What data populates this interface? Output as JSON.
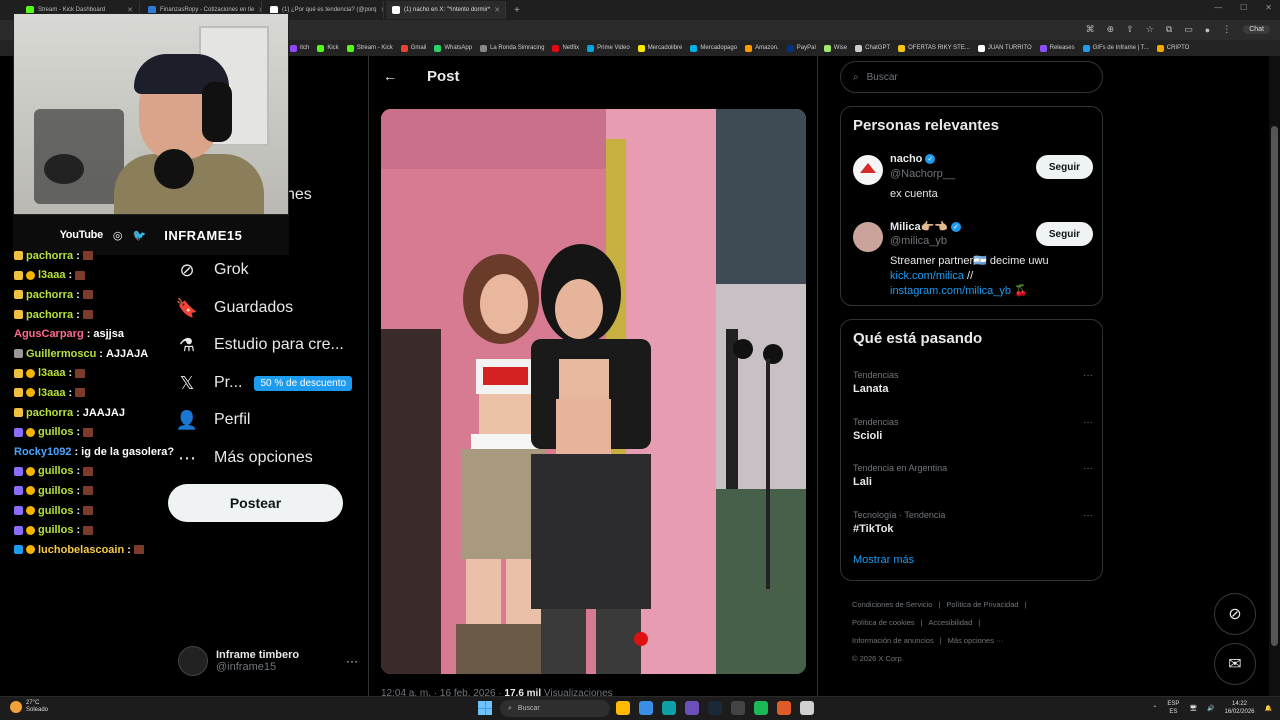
{
  "browser": {
    "tabs": [
      {
        "label": "Stream - Kick Dashboard",
        "color": "#53fc18"
      },
      {
        "label": "FinanzasRopy - Cotizaciones en tie",
        "color": "#2e7bd6"
      },
      {
        "label": "(1) ¿Por qué es tendencia? (@porq",
        "color": "#ffffff"
      },
      {
        "label": "(1) nacho en X: \"*intento dormir*",
        "color": "#ffffff"
      }
    ],
    "new_tab": "+",
    "chat_button": "Chat",
    "bookmarks": [
      {
        "label": "itch",
        "color": "#9146ff"
      },
      {
        "label": "Kick",
        "color": "#53fc18"
      },
      {
        "label": "Stream - Kick",
        "color": "#53fc18"
      },
      {
        "label": "Gmail",
        "color": "#ea4335"
      },
      {
        "label": "WhatsApp",
        "color": "#25d366"
      },
      {
        "label": "La Ronda Simracing",
        "color": "#888888"
      },
      {
        "label": "Netflix",
        "color": "#e50914"
      },
      {
        "label": "Prime Video",
        "color": "#00a8e1"
      },
      {
        "label": "Mercadolibre",
        "color": "#ffe600"
      },
      {
        "label": "Mercadopago",
        "color": "#00b1ea"
      },
      {
        "label": "Amazon.",
        "color": "#ff9900"
      },
      {
        "label": "PayPal",
        "color": "#003087"
      },
      {
        "label": "Wise",
        "color": "#9fe870"
      },
      {
        "label": "ChatGPT",
        "color": "#cccccc"
      },
      {
        "label": "OFERTAS RIKY STE...",
        "color": "#f5c518"
      },
      {
        "label": "JUAN TURRITO",
        "color": "#ffffff"
      },
      {
        "label": "Releases",
        "color": "#8a4fff"
      },
      {
        "label": "GIFs de Inframe | T...",
        "color": "#1d9bf0"
      },
      {
        "label": "CRIPTO",
        "color": "#f2a900"
      }
    ]
  },
  "stream_overlay": {
    "platform": "YouTube",
    "handle": "INFRAME15"
  },
  "chat": [
    {
      "user": "pachorra",
      "msg": "",
      "color": "#b7e23a",
      "emote": true,
      "badges": [
        "#f0c040"
      ]
    },
    {
      "user": "l3aaa",
      "msg": "",
      "color": "#b7e23a",
      "emote": true,
      "badges": [
        "#f0c040",
        "#f5b400"
      ]
    },
    {
      "user": "pachorra",
      "msg": "",
      "color": "#b7e23a",
      "emote": true,
      "badges": [
        "#f0c040"
      ]
    },
    {
      "user": "pachorra",
      "msg": "",
      "color": "#b7e23a",
      "emote": true,
      "badges": [
        "#f0c040"
      ]
    },
    {
      "user": "AgusCarparg",
      "msg": "asjjsa",
      "color": "#ff6b8b",
      "emote": false,
      "badges": []
    },
    {
      "user": "Guillermoscu",
      "msg": "AJJAJA",
      "color": "#b7e23a",
      "emote": false,
      "badges": [
        "#999999"
      ]
    },
    {
      "user": "l3aaa",
      "msg": "",
      "color": "#b7e23a",
      "emote": true,
      "badges": [
        "#f0c040",
        "#f5b400"
      ]
    },
    {
      "user": "l3aaa",
      "msg": "",
      "color": "#b7e23a",
      "emote": true,
      "badges": [
        "#f0c040",
        "#f5b400"
      ]
    },
    {
      "user": "pachorra",
      "msg": "JAAJAJ",
      "color": "#b7e23a",
      "emote": false,
      "badges": [
        "#f0c040"
      ]
    },
    {
      "user": "guillos",
      "msg": "",
      "color": "#b7e23a",
      "emote": true,
      "badges": [
        "#8a6cff",
        "#f5b400"
      ]
    },
    {
      "user": "Rocky1092",
      "msg": "ig de la gasolera?",
      "color": "#4aa3ff",
      "emote": false,
      "badges": []
    },
    {
      "user": "guillos",
      "msg": "",
      "color": "#b7e23a",
      "emote": true,
      "badges": [
        "#8a6cff",
        "#f5b400"
      ]
    },
    {
      "user": "guillos",
      "msg": "",
      "color": "#b7e23a",
      "emote": true,
      "badges": [
        "#8a6cff",
        "#f5b400"
      ]
    },
    {
      "user": "guillos",
      "msg": "",
      "color": "#b7e23a",
      "emote": true,
      "badges": [
        "#8a6cff",
        "#f5b400"
      ]
    },
    {
      "user": "guillos",
      "msg": "",
      "color": "#b7e23a",
      "emote": true,
      "badges": [
        "#8a6cff",
        "#f5b400"
      ]
    },
    {
      "user": "luchobelascoain",
      "msg": "",
      "color": "#f7c948",
      "emote": true,
      "badges": [
        "#1d9bf0",
        "#f5b400"
      ]
    }
  ],
  "nav": {
    "partial_label": "nes",
    "items": [
      {
        "label": "Grok",
        "icon": "grok-icon",
        "glyph": "⊘"
      },
      {
        "label": "Guardados",
        "icon": "bookmark-icon",
        "glyph": "🔖"
      },
      {
        "label": "Estudio para cre...",
        "icon": "flask-icon",
        "glyph": "⚗"
      },
      {
        "label": "Pr...",
        "icon": "x-logo-icon",
        "glyph": "𝕏"
      },
      {
        "label": "Perfil",
        "icon": "person-icon",
        "glyph": "👤"
      },
      {
        "label": "Más opciones",
        "icon": "more-circle-icon",
        "glyph": "⋯"
      }
    ],
    "promo": "50 % de descuento",
    "post_button": "Postear",
    "account": {
      "name": "Inframe timbero",
      "handle": "@inframe15",
      "more": "···"
    }
  },
  "main": {
    "back": "←",
    "title": "Post",
    "meta_time": "12:04 a. m. · 16 feb. 2026 ·",
    "meta_views_count": "17,6 mil",
    "meta_views_label": "Visualizaciones"
  },
  "sidebar": {
    "search_placeholder": "Buscar",
    "people_title": "Personas relevantes",
    "people": [
      {
        "name": "nacho",
        "handle": "@Nachorp__",
        "bio": "ex cuenta",
        "follow": "Seguir"
      },
      {
        "name": "Milica👉🏼👈🏼",
        "handle": "@milica_yb",
        "bio_line1": "Streamer partner🇦🇷 decime uwu",
        "link1": "kick.com/milica",
        "sep": "//",
        "link2": "instagram.com/milica_yb",
        "emoji": "🍒",
        "follow": "Seguir"
      }
    ],
    "trending_title": "Qué está pasando",
    "trends": [
      {
        "context": "Tendencias",
        "name": "Lanata"
      },
      {
        "context": "Tendencias",
        "name": "Scioli"
      },
      {
        "context": "Tendencia en Argentina",
        "name": "Lali"
      },
      {
        "context": "Tecnología · Tendencia",
        "name": "#TikTok"
      }
    ],
    "show_more": "Mostrar más",
    "footer": [
      "Condiciones de Servicio",
      "|",
      "Política de Privacidad",
      "|",
      "Política de cookies",
      "|",
      "Accesibilidad",
      "|",
      "Información de anuncios",
      "|",
      "Más opciones ···",
      "© 2026 X Corp."
    ]
  },
  "taskbar": {
    "temp": "27°C",
    "weather": "Soleado",
    "search": "Buscar",
    "lang1": "ESP",
    "lang2": "ES",
    "time": "14:22",
    "date": "16/02/2026",
    "app_colors": [
      "#ffb900",
      "#3a8ee6",
      "#0e9ea5",
      "#6b4fbb",
      "#1b2838",
      "#444444",
      "#1db954",
      "#e05a2a",
      "#d0d0d0"
    ]
  }
}
